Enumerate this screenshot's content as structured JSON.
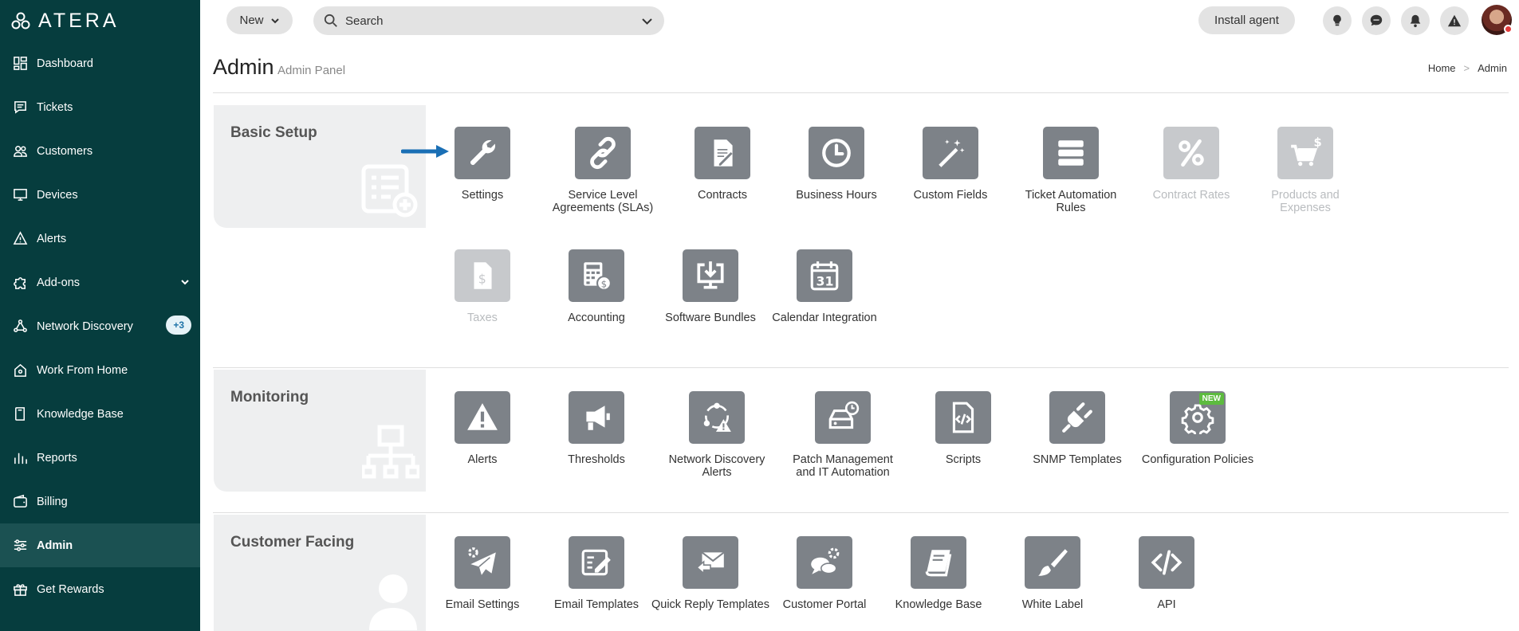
{
  "app": {
    "logo_text": "ATERA"
  },
  "sidebar": {
    "items": [
      {
        "label": "Dashboard",
        "icon": "dashboard-icon"
      },
      {
        "label": "Tickets",
        "icon": "tickets-icon"
      },
      {
        "label": "Customers",
        "icon": "customers-icon"
      },
      {
        "label": "Devices",
        "icon": "devices-icon"
      },
      {
        "label": "Alerts",
        "icon": "alert-icon"
      },
      {
        "label": "Add-ons",
        "icon": "puzzle-icon"
      },
      {
        "label": "Network Discovery",
        "icon": "network-icon",
        "badge": "+3"
      },
      {
        "label": "Work From Home",
        "icon": "home-icon"
      },
      {
        "label": "Knowledge Base",
        "icon": "book-icon"
      },
      {
        "label": "Reports",
        "icon": "reports-icon"
      },
      {
        "label": "Billing",
        "icon": "wallet-icon"
      },
      {
        "label": "Admin",
        "icon": "sliders-icon",
        "active": true
      },
      {
        "label": "Get Rewards",
        "icon": "gift-icon"
      }
    ]
  },
  "topbar": {
    "new_label": "New",
    "search_placeholder": "Search",
    "install_agent_label": "Install agent"
  },
  "page": {
    "title": "Admin",
    "subtitle": "Admin Panel",
    "breadcrumb": [
      "Home",
      "Admin"
    ]
  },
  "sections": {
    "basic_setup": {
      "title": "Basic Setup",
      "items": [
        {
          "label": "Settings",
          "icon": "wrench-icon",
          "enabled": true
        },
        {
          "label": "Service Level Agreements (SLAs)",
          "icon": "link-icon",
          "enabled": true
        },
        {
          "label": "Contracts",
          "icon": "contract-icon",
          "enabled": true
        },
        {
          "label": "Business Hours",
          "icon": "clock-icon",
          "enabled": true
        },
        {
          "label": "Custom Fields",
          "icon": "magic-wand-icon",
          "enabled": true
        },
        {
          "label": "Ticket Automation Rules",
          "icon": "server-icon",
          "enabled": true
        },
        {
          "label": "Contract Rates",
          "icon": "percent-icon",
          "enabled": false
        },
        {
          "label": "Products and Expenses",
          "icon": "cart-icon",
          "enabled": false
        },
        {
          "label": "Taxes",
          "icon": "tax-document-icon",
          "enabled": false
        },
        {
          "label": "Accounting",
          "icon": "calculator-icon",
          "enabled": true
        },
        {
          "label": "Software Bundles",
          "icon": "download-monitor-icon",
          "enabled": true
        },
        {
          "label": "Calendar Integration",
          "icon": "calendar-icon",
          "enabled": true
        }
      ]
    },
    "monitoring": {
      "title": "Monitoring",
      "items": [
        {
          "label": "Alerts",
          "icon": "warning-icon"
        },
        {
          "label": "Thresholds",
          "icon": "megaphone-icon"
        },
        {
          "label": "Network Discovery Alerts",
          "icon": "network-alert-icon"
        },
        {
          "label": "Patch Management and IT Automation",
          "icon": "hard-drive-clock-icon"
        },
        {
          "label": "Scripts",
          "icon": "code-file-icon"
        },
        {
          "label": "SNMP Templates",
          "icon": "plug-icon"
        },
        {
          "label": "Configuration Policies",
          "icon": "gear-icon",
          "badge": "NEW"
        }
      ]
    },
    "customer_facing": {
      "title": "Customer Facing",
      "items": [
        {
          "label": "Email Settings",
          "icon": "paper-plane-gear-icon"
        },
        {
          "label": "Email Templates",
          "icon": "edit-template-icon"
        },
        {
          "label": "Quick Reply Templates",
          "icon": "reply-mail-icon"
        },
        {
          "label": "Customer Portal",
          "icon": "chat-gear-icon"
        },
        {
          "label": "Knowledge Base",
          "icon": "book-icon"
        },
        {
          "label": "White Label",
          "icon": "brush-icon"
        },
        {
          "label": "API",
          "icon": "code-icon"
        }
      ]
    }
  }
}
